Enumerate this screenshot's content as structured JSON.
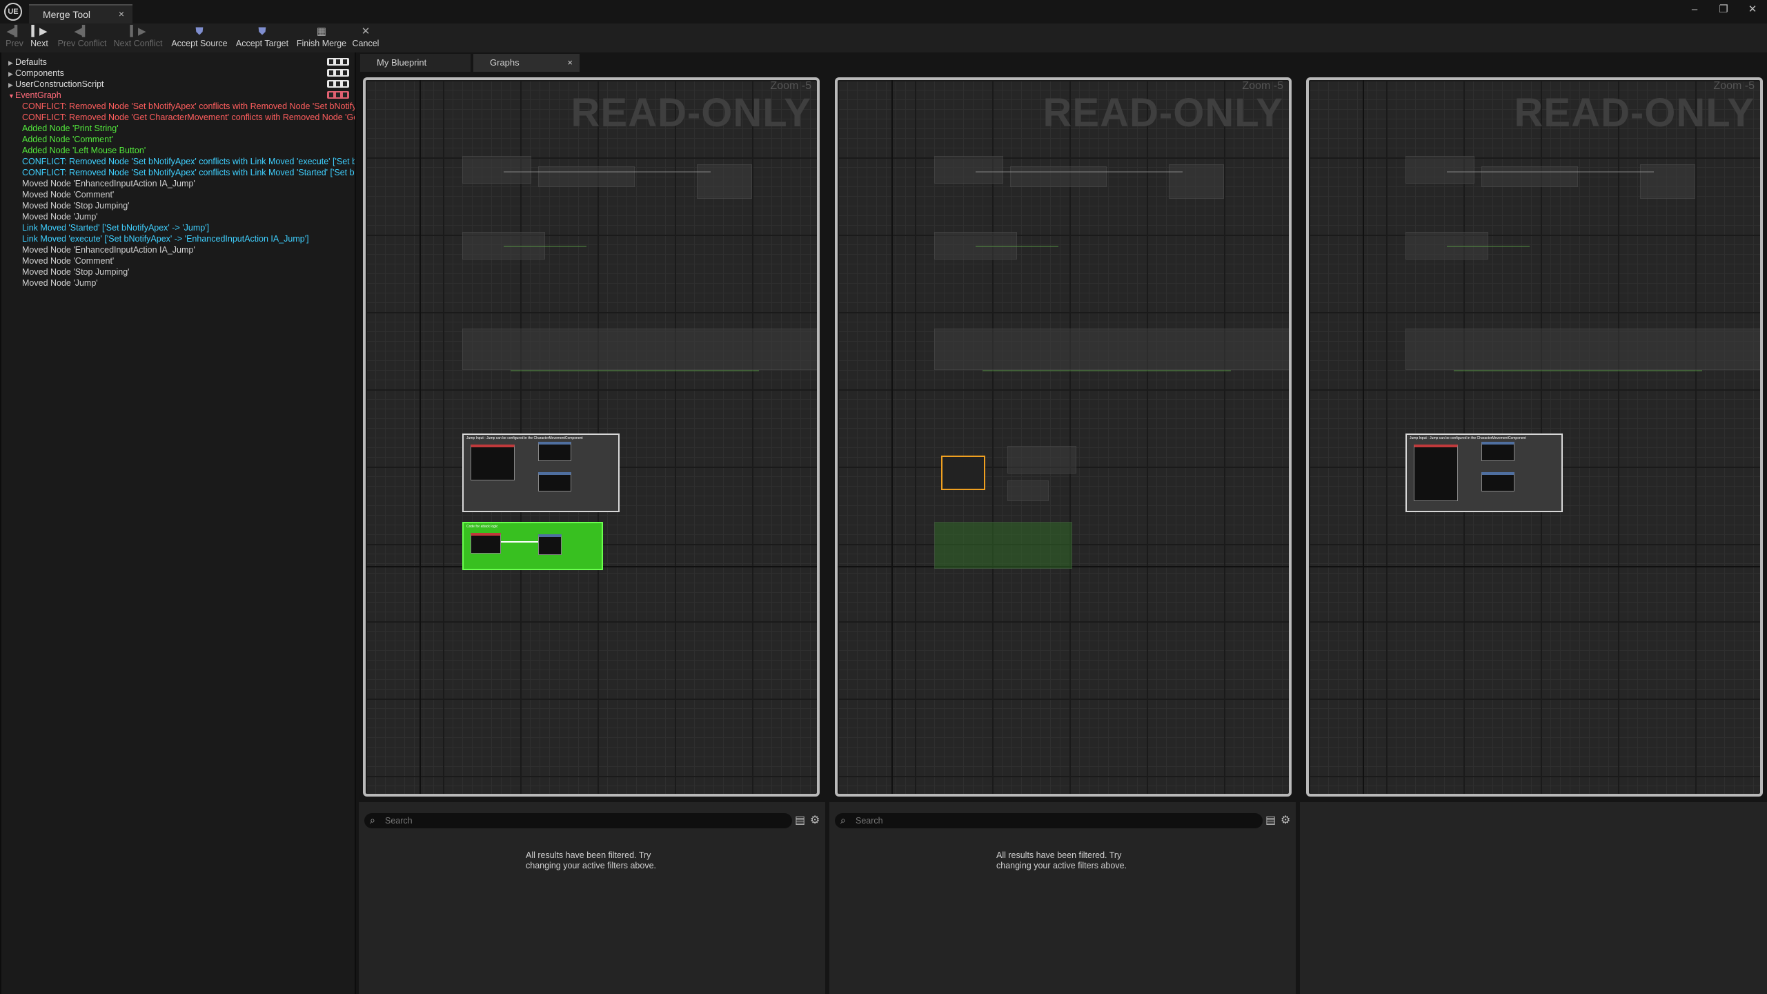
{
  "window": {
    "tab_title": "Merge Tool",
    "tab_close": "×",
    "logo": "UE",
    "controls": [
      "–",
      "❐",
      "✕"
    ]
  },
  "toolbar": {
    "buttons": [
      {
        "label": "Prev",
        "icon": "prev-arrow-icon",
        "enabled": false
      },
      {
        "label": "Next",
        "icon": "next-arrow-icon",
        "enabled": true
      },
      {
        "label": "Prev Conflict",
        "icon": "prev-conflict-icon",
        "enabled": false
      },
      {
        "label": "Next Conflict",
        "icon": "next-conflict-icon",
        "enabled": false
      },
      {
        "label": "Accept Source",
        "icon": "accept-source-icon",
        "enabled": true
      },
      {
        "label": "Accept Target",
        "icon": "accept-target-icon",
        "enabled": true
      },
      {
        "label": "Finish Merge",
        "icon": "finish-merge-icon",
        "enabled": true
      },
      {
        "label": "Cancel",
        "icon": "cancel-icon",
        "enabled": true
      }
    ]
  },
  "tree": {
    "categories": [
      {
        "label": "Defaults",
        "expanded": false
      },
      {
        "label": "Components",
        "expanded": false
      },
      {
        "label": "UserConstructionScript",
        "expanded": false
      },
      {
        "label": "EventGraph",
        "expanded": true
      }
    ],
    "changes": [
      {
        "text": "CONFLICT: Removed Node 'Set bNotifyApex' conflicts with Removed Node 'Set bNotifyApex'",
        "kind": "conflict"
      },
      {
        "text": "CONFLICT: Removed Node 'Get CharacterMovement' conflicts with Removed Node 'Get CharacterMovement'",
        "kind": "conflict"
      },
      {
        "text": "Added Node 'Print String'",
        "kind": "added"
      },
      {
        "text": "Added Node 'Comment'",
        "kind": "added"
      },
      {
        "text": "Added Node 'Left Mouse Button'",
        "kind": "added"
      },
      {
        "text": "CONFLICT: Removed Node 'Set bNotifyApex' conflicts with Link Moved 'execute' ['Set bNotifyApex']",
        "kind": "link-conflict"
      },
      {
        "text": "CONFLICT: Removed Node 'Set bNotifyApex' conflicts with Link Moved 'Started' ['Set bNotifyApex']",
        "kind": "link-conflict"
      },
      {
        "text": "Moved Node 'EnhancedInputAction IA_Jump'",
        "kind": "moved"
      },
      {
        "text": "Moved Node 'Comment'",
        "kind": "moved"
      },
      {
        "text": "Moved Node 'Stop Jumping'",
        "kind": "moved"
      },
      {
        "text": "Moved Node 'Jump'",
        "kind": "moved"
      },
      {
        "text": "Link Moved 'Started' ['Set bNotifyApex' -> 'Jump']",
        "kind": "link"
      },
      {
        "text": "Link Moved 'execute' ['Set bNotifyApex' -> 'EnhancedInputAction IA_Jump']",
        "kind": "link"
      },
      {
        "text": "Moved Node 'EnhancedInputAction IA_Jump'",
        "kind": "moved"
      },
      {
        "text": "Moved Node 'Comment'",
        "kind": "moved"
      },
      {
        "text": "Moved Node 'Stop Jumping'",
        "kind": "moved"
      },
      {
        "text": "Moved Node 'Jump'",
        "kind": "moved"
      }
    ],
    "colors": {
      "conflict": "#ff5e5e",
      "added": "#53e93c",
      "link": "#3fd0ff",
      "moved": "#d0d0d0"
    }
  },
  "panel_tabs": {
    "my_blueprint": "My Blueprint",
    "graphs": "Graphs",
    "close": "×"
  },
  "graphs": [
    {
      "watermark": "READ-ONLY",
      "zoom": "Zoom -5",
      "comment": "Jump Input - Jump can be configured in the CharacterMovementComponent",
      "green_comment": "Code for attack logic"
    },
    {
      "watermark": "READ-ONLY",
      "zoom": "Zoom -5"
    },
    {
      "watermark": "READ-ONLY",
      "zoom": "Zoom -5",
      "comment": "Jump Input - Jump can be configured in the CharacterMovementComponent"
    }
  ],
  "details": [
    {
      "search_placeholder": "Search",
      "message": "All results have been filtered. Try changing your active filters above."
    },
    {
      "search_placeholder": "Search",
      "message": "All results have been filtered. Try changing your active filters above."
    }
  ]
}
